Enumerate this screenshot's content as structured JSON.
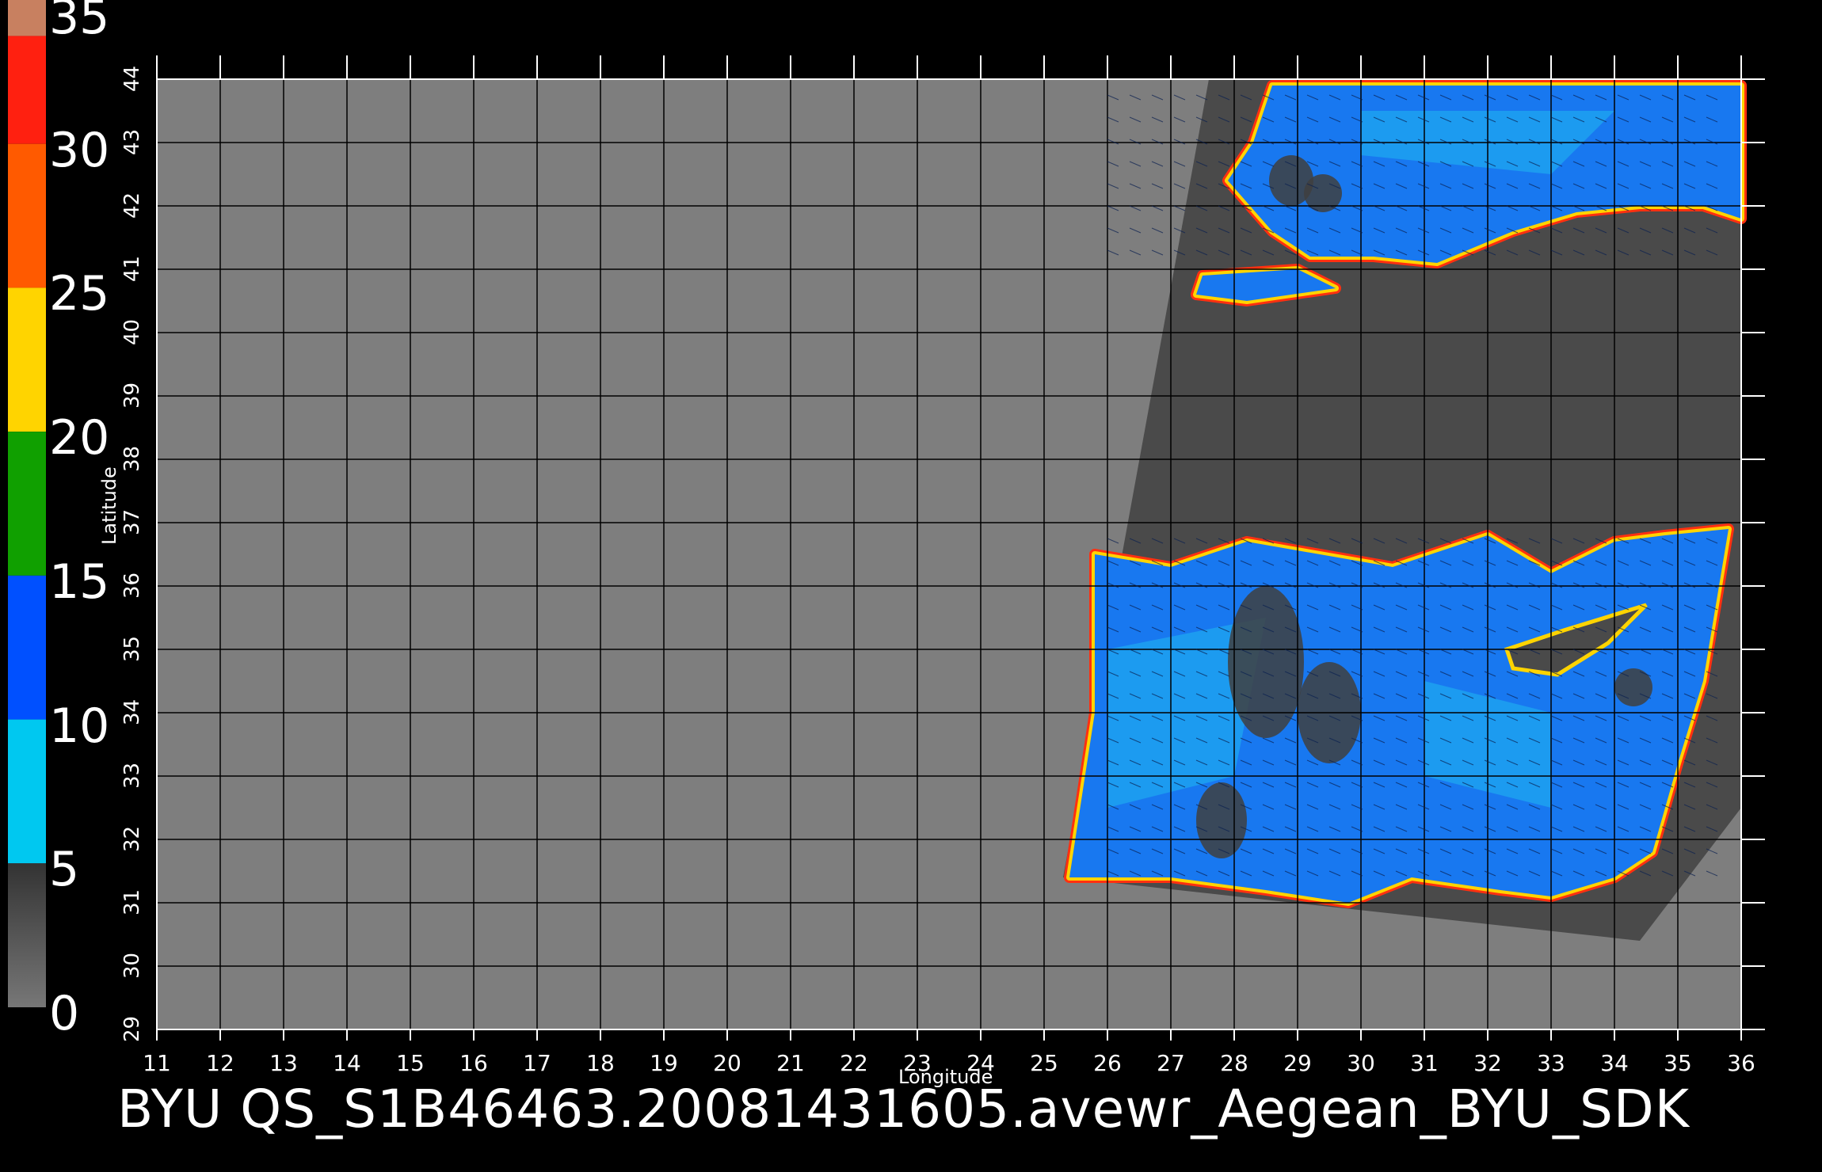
{
  "colorbar": {
    "tick_labels": [
      "35",
      "30",
      "25",
      "20",
      "15",
      "10",
      "5",
      "0"
    ],
    "segments": [
      {
        "from": 33.75,
        "to": 35,
        "color": "#c88060"
      },
      {
        "from": 30,
        "to": 33.75,
        "color": "#ff2010"
      },
      {
        "from": 25,
        "to": 30,
        "color": "#ff5a00"
      },
      {
        "from": 20,
        "to": 25,
        "color": "#ffd400"
      },
      {
        "from": 15,
        "to": 20,
        "color": "#10a000"
      },
      {
        "from": 10,
        "to": 15,
        "color": "#0050ff"
      },
      {
        "from": 5,
        "to": 10,
        "color": "#00c8f0"
      },
      {
        "from": 0,
        "to": 5,
        "color": "#444444"
      }
    ]
  },
  "map": {
    "xlabel": "Longitude",
    "ylabel": "Latitude",
    "lon_range": [
      11,
      36
    ],
    "lat_range": [
      29,
      44
    ],
    "lon_ticks": [
      "11",
      "12",
      "13",
      "14",
      "15",
      "16",
      "17",
      "18",
      "19",
      "20",
      "21",
      "22",
      "23",
      "24",
      "25",
      "26",
      "27",
      "28",
      "29",
      "30",
      "31",
      "32",
      "33",
      "34",
      "35",
      "36"
    ],
    "lat_ticks": [
      "29",
      "30",
      "31",
      "32",
      "33",
      "34",
      "35",
      "36",
      "37",
      "38",
      "39",
      "40",
      "41",
      "42",
      "43",
      "44"
    ],
    "background_color": "#7e7e7e",
    "swath_color": "#4a4a4a",
    "ocean_color": "#1878f0"
  },
  "footer": {
    "filename": "BYU  QS_S1B46463.20081431605.avewr_Aegean_BYU_SDK"
  }
}
